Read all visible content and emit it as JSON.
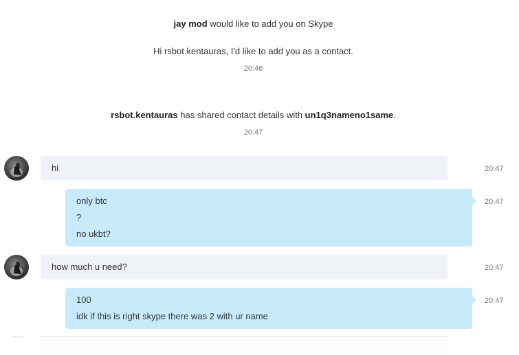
{
  "request": {
    "sender": "jay mod",
    "text": " would like to add you on Skype",
    "message": "Hi rsbot.kentauras, I'd like to add you as a contact.",
    "time": "20:46"
  },
  "share": {
    "from": "rsbot.kentauras",
    "middle": " has shared contact details with ",
    "to": "un1q3nameno1same",
    "end": ".",
    "time": "20:47"
  },
  "messages": [
    {
      "direction": "incoming",
      "lines": [
        "hi"
      ],
      "time": "20:47"
    },
    {
      "direction": "outgoing",
      "lines": [
        "only btc",
        "?",
        "no ukbt?"
      ],
      "time": "20:47"
    },
    {
      "direction": "incoming",
      "lines": [
        "how much u need?"
      ],
      "time": "20:47"
    },
    {
      "direction": "outgoing",
      "lines": [
        "100",
        "idk if this is right skype there was 2 with ur name"
      ],
      "time": "20:47"
    }
  ],
  "colors": {
    "incoming_bubble": "#eff2f6",
    "outgoing_bubble": "#c7ebfb",
    "timestamp": "#6f7d87",
    "text": "#333333"
  },
  "icons": {
    "avatar": "contact-avatar"
  }
}
